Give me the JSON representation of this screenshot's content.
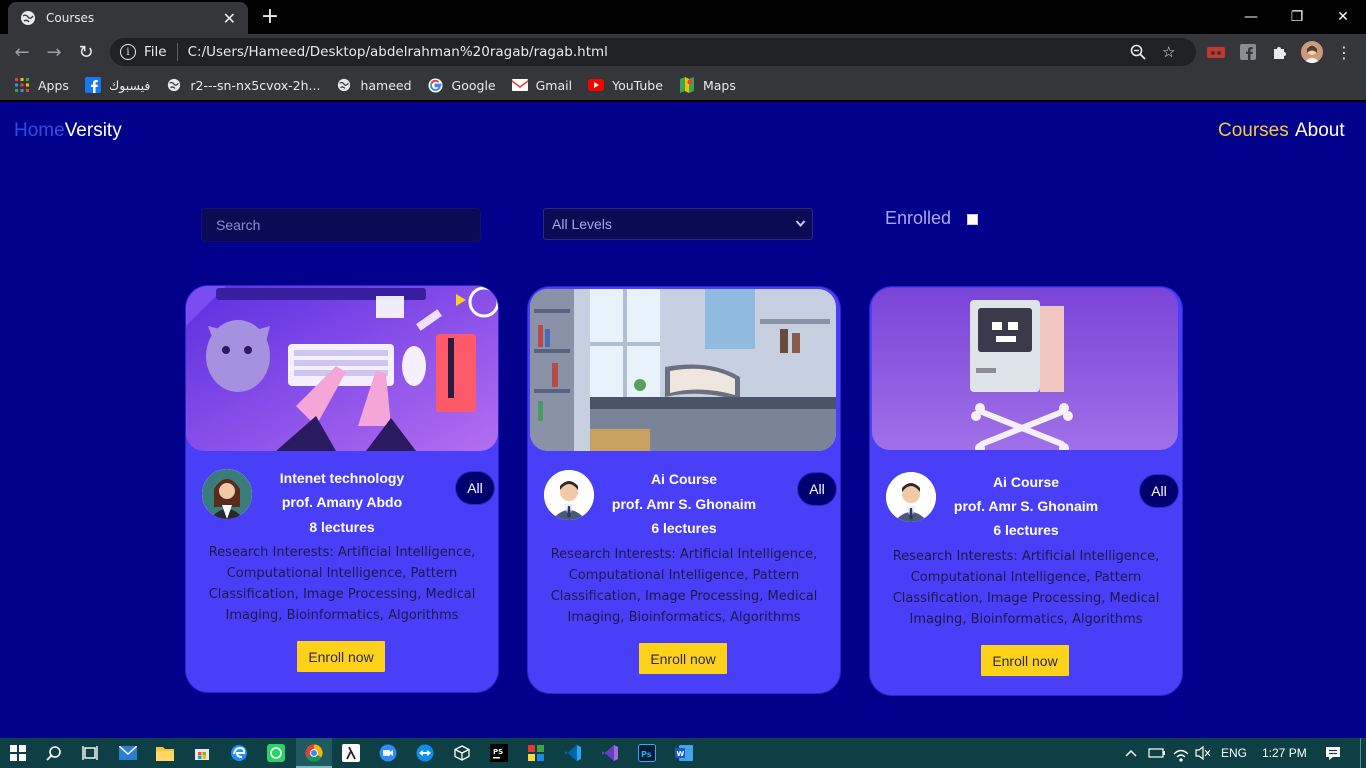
{
  "browser": {
    "tab_title": "Courses",
    "url_label": "File",
    "url": "C:/Users/Hameed/Desktop/abdelrahman%20ragab/ragab.html",
    "bookmarks": [
      {
        "label": "Apps",
        "icon": "apps-grid-icon"
      },
      {
        "label": "فيسبوك",
        "icon": "facebook-icon"
      },
      {
        "label": "r2---sn-nx5cvox-2h...",
        "icon": "globe-icon"
      },
      {
        "label": "hameed",
        "icon": "globe-icon"
      },
      {
        "label": "Google",
        "icon": "google-icon"
      },
      {
        "label": "Gmail",
        "icon": "gmail-icon"
      },
      {
        "label": "YouTube",
        "icon": "youtube-icon"
      },
      {
        "label": "Maps",
        "icon": "maps-icon"
      }
    ]
  },
  "site": {
    "brand_home": "Home",
    "brand_versity": "Versity",
    "nav": {
      "courses": "Courses",
      "about": "About"
    },
    "colors": {
      "background": "#01018b",
      "card": "#4a3ff8",
      "accent": "#ffd21a",
      "home": "#2a4ee6",
      "courses_link": "#f5c842"
    }
  },
  "filters": {
    "search_placeholder": "Search",
    "level_selected": "All Levels",
    "enrolled_label": "Enrolled",
    "enrolled_checked": false
  },
  "courses": [
    {
      "title": "Intenet technology",
      "instructor": "prof. Amany Abdo",
      "lectures": "8 lectures",
      "level_badge": "All",
      "description": "Research Interests: Artificial Intelligence, Computational Intelligence, Pattern Classification, Image Processing, Medical Imaging, Bioinformatics, Algorithms",
      "button": "Enroll now"
    },
    {
      "title": "Ai Course",
      "instructor": "prof. Amr S. Ghonaim",
      "lectures": "6 lectures",
      "level_badge": "All",
      "description": "Research Interests: Artificial Intelligence, Computational Intelligence, Pattern Classification, Image Processing, Medical Imaging, Bioinformatics, Algorithms",
      "button": "Enroll now"
    },
    {
      "title": "Ai Course",
      "instructor": "prof. Amr S. Ghonaim",
      "lectures": "6 lectures",
      "level_badge": "All",
      "description": "Research Interests: Artificial Intelligence, Computational Intelligence, Pattern Classification, Image Processing, Medical Imaging, Bioinformatics, Algorithms",
      "button": "Enroll now"
    }
  ],
  "taskbar": {
    "language": "ENG",
    "time": "1:27 PM"
  }
}
